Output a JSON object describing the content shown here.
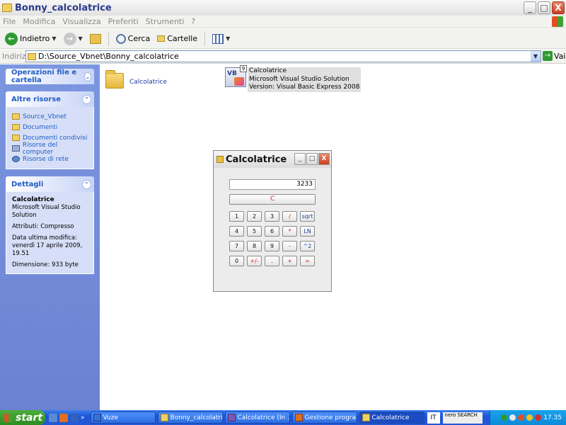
{
  "window": {
    "title": "Bonny_calcolatrice",
    "buttons": {
      "minimize": "_",
      "maximize": "□",
      "close": "X"
    }
  },
  "menu": [
    "File",
    "Modifica",
    "Visualizza",
    "Preferiti",
    "Strumenti",
    "?"
  ],
  "toolbar": {
    "back_label": "Indietro",
    "search_label": "Cerca",
    "folders_label": "Cartelle"
  },
  "address": {
    "label": "Indirizzo",
    "path": "D:\\Source_Vbnet\\Bonny_calcolatrice",
    "go_label": "Vai"
  },
  "sidebar": {
    "file_ops": {
      "title": "Operazioni file e cartella"
    },
    "other_places": {
      "title": "Altre risorse",
      "items": [
        "Source_Vbnet",
        "Documenti",
        "Documenti condivisi",
        "Risorse del computer",
        "Risorse di rete"
      ]
    },
    "details": {
      "title": "Dettagli",
      "name": "Calcolatrice",
      "type": "Microsoft Visual Studio Solution",
      "attributes": "Attributi: Compresso",
      "modified": "Data ultima modifica: venerdì 17 aprile 2009, 19.51",
      "size": "Dimensione: 933 byte"
    }
  },
  "files": [
    {
      "name": "Calcolatrice",
      "kind": "folder"
    },
    {
      "name": "Calcolatrice",
      "line2": "Microsoft Visual Studio Solution",
      "line3": "Version: Visual Basic Express 2008",
      "kind": "solution"
    }
  ],
  "calculator": {
    "title": "Calcolatrice",
    "display": "3233",
    "clear_label": "C",
    "keys": [
      "1",
      "2",
      "3",
      "/",
      "sqrt",
      "4",
      "5",
      "6",
      "*",
      "LN",
      "7",
      "8",
      "9",
      "-",
      "^2",
      "0",
      "+/-",
      ".",
      "+",
      "="
    ]
  },
  "taskbar": {
    "start_label": "start",
    "tasks": [
      "Vuze",
      "Bonny_calcolatrice",
      "Calcolatrice (In ...",
      "Gestione progra...",
      "Calcolatrice"
    ],
    "lang": "IT",
    "nero": "nero SEARCH",
    "clock": "17.35"
  }
}
